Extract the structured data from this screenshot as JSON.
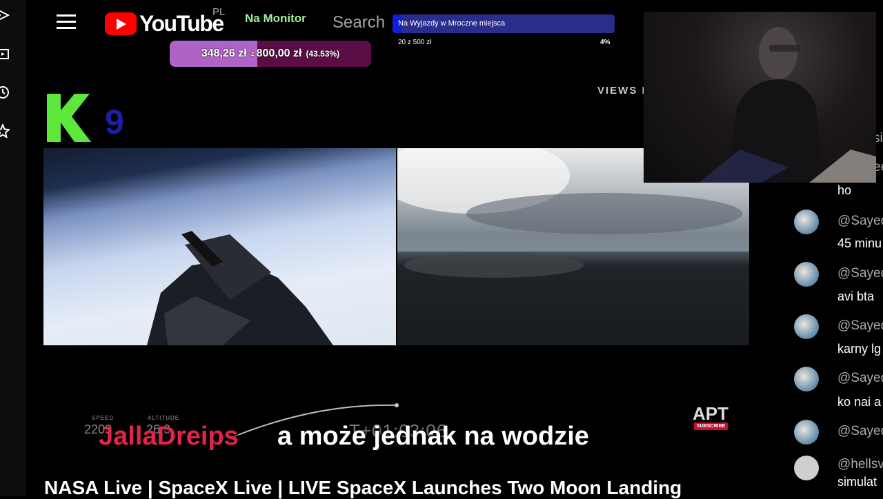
{
  "header": {
    "logo_text": "YouTube",
    "region": "PL",
    "channel_badge": "Na Monitor",
    "search_placeholder": "Search"
  },
  "donation_goal": {
    "current": "348,26 zł",
    "separator": "z",
    "target": "800,00 zł",
    "percent_label": "(43.53%)",
    "progress": 0.4353,
    "fill_color": "#b063c7",
    "track_color": "#5a0e44"
  },
  "tip_goal": {
    "title": "Na Wyjazdy w Mroczne miejsca",
    "progress_text": "20 z 500 zł",
    "percent": "4%",
    "progress": 0.04,
    "fill_color": "#0f1fd4"
  },
  "overlay": {
    "k9_digit": "9",
    "views_label": "VIEWS I",
    "hud": {
      "speed_label": "SPEED",
      "speed_value": "2203",
      "altitude_label": "ALTITUDE",
      "altitude_value": "26.0",
      "timer": "T+01:03:06"
    },
    "apt_logo": "APT",
    "subscribe": "SUBSCRIBE"
  },
  "chat_overlay": {
    "username": "JallaDreips",
    "message": "a może jednak na wodzie"
  },
  "video": {
    "title": "NASA Live | SpaceX Live | LIVE SpaceX Launches Two Moon Landing"
  },
  "chat": {
    "partial_lines": [
      "si",
      "ee",
      "ho"
    ],
    "messages": [
      {
        "author": "@Sayed",
        "text": "45 minu"
      },
      {
        "author": "@Sayed",
        "text": "avi bta"
      },
      {
        "author": "@Sayed",
        "text": "karny lg"
      },
      {
        "author": "@Sayed",
        "text": "ko nai a"
      },
      {
        "author": "@Sayed",
        "text": ""
      },
      {
        "author": "@hellsv",
        "text": "simulat"
      }
    ]
  },
  "icons": {
    "sidebar": [
      "explore-icon",
      "subscriptions-icon",
      "history-icon",
      "shorts-icon"
    ],
    "menu": "hamburger-menu-icon"
  }
}
